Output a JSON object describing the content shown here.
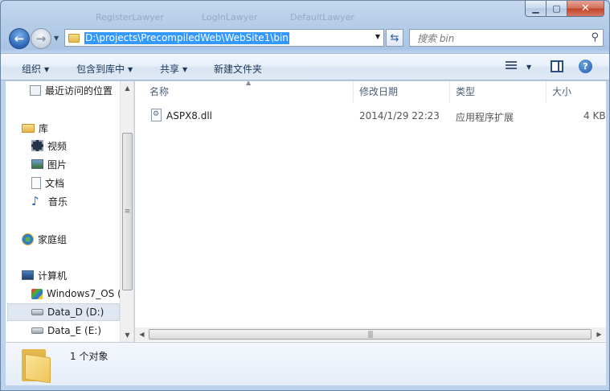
{
  "nav": {
    "address": "D:\\projects\\PrecompiledWeb\\WebSite1\\bin",
    "search_placeholder": "搜索 bin"
  },
  "toolbar": {
    "organize": "组织",
    "include_in_library": "包含到库中",
    "share": "共享",
    "new_folder": "新建文件夹"
  },
  "sidebar": {
    "items": [
      {
        "label": "最近访问的位置",
        "icon": "recent-places-icon"
      },
      {
        "label": "库",
        "icon": "libraries-icon"
      },
      {
        "label": "视频",
        "icon": "videos-icon"
      },
      {
        "label": "图片",
        "icon": "pictures-icon"
      },
      {
        "label": "文档",
        "icon": "documents-icon"
      },
      {
        "label": "音乐",
        "icon": "music-icon"
      },
      {
        "label": "家庭组",
        "icon": "homegroup-icon"
      },
      {
        "label": "计算机",
        "icon": "computer-icon"
      },
      {
        "label": "Windows7_OS (",
        "icon": "os-drive-icon"
      },
      {
        "label": "Data_D (D:)",
        "icon": "drive-icon"
      },
      {
        "label": "Data_E (E:)",
        "icon": "drive-icon"
      }
    ]
  },
  "columns": {
    "name": "名称",
    "modified": "修改日期",
    "type": "类型",
    "size": "大小"
  },
  "files": [
    {
      "name": "ASPX8.dll",
      "modified": "2014/1/29 22:23",
      "type": "应用程序扩展",
      "size": "4 KB"
    }
  ],
  "status": {
    "count": "1 个对象"
  },
  "background_ghost": [
    "RegisterLawyer",
    "LogInLawyer",
    "DefaultLawyer"
  ],
  "colors": {
    "selection": "#3399ff",
    "window_frame": "#b9d1ea"
  }
}
